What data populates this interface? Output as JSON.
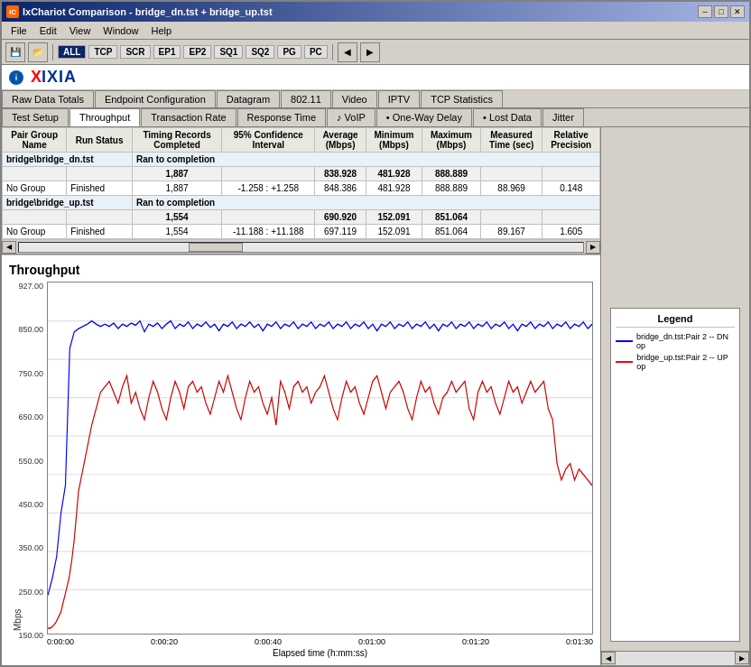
{
  "window": {
    "title": "IxChariot Comparison - bridge_dn.tst + bridge_up.tst",
    "icon": "IC"
  },
  "menu": {
    "items": [
      "File",
      "Edit",
      "View",
      "Window",
      "Help"
    ]
  },
  "toolbar": {
    "tags": [
      "ALL",
      "TCP",
      "SCR",
      "EP1",
      "EP2",
      "SQ1",
      "SQ2",
      "PG",
      "PC"
    ]
  },
  "tabs_row1": {
    "items": [
      "Raw Data Totals",
      "Endpoint Configuration",
      "Datagram",
      "802.11",
      "Video",
      "IPTV",
      "TCP Statistics"
    ]
  },
  "tabs_row2": {
    "items": [
      "Test Setup",
      "Throughput",
      "Transaction Rate",
      "Response Time",
      "VoIP",
      "One-Way Delay",
      "Lost Data",
      "Jitter"
    ]
  },
  "table": {
    "headers": {
      "pair_group_name": "Pair Group Name",
      "run_status": "Run Status",
      "timing_records_completed": "Timing Records Completed",
      "confidence_interval": "95% Confidence Interval",
      "average_mbps": "Average (Mbps)",
      "minimum_mbps": "Minimum (Mbps)",
      "maximum_mbps": "Maximum (Mbps)",
      "measured_time": "Measured Time (sec)",
      "relative_precision": "Relative Precision"
    },
    "rows": [
      {
        "type": "file",
        "file": "bridge\\bridge_dn.tst",
        "run_status": "Ran to completion",
        "timing_records": "",
        "confidence": "",
        "average": "",
        "minimum": "",
        "maximum": "",
        "measured_time": "",
        "relative_precision": ""
      },
      {
        "type": "summary",
        "file": "",
        "run_status": "",
        "timing_records": "1,887",
        "confidence": "",
        "average": "838.928",
        "minimum": "481.928",
        "maximum": "888.889",
        "measured_time": "",
        "relative_precision": ""
      },
      {
        "type": "detail",
        "pair_group": "No Group",
        "run_status": "Finished",
        "timing_records": "1,887",
        "confidence": "-1.258 : +1.258",
        "average": "848.386",
        "minimum": "481.928",
        "maximum": "888.889",
        "measured_time": "88.969",
        "relative_precision": "0.148"
      },
      {
        "type": "file",
        "file": "bridge\\bridge_up.tst",
        "run_status": "Ran to completion",
        "timing_records": "",
        "confidence": "",
        "average": "",
        "minimum": "",
        "maximum": "",
        "measured_time": "",
        "relative_precision": ""
      },
      {
        "type": "summary",
        "file": "",
        "run_status": "",
        "timing_records": "1,554",
        "confidence": "",
        "average": "690.920",
        "minimum": "152.091",
        "maximum": "851.064",
        "measured_time": "",
        "relative_precision": ""
      },
      {
        "type": "detail",
        "pair_group": "No Group",
        "run_status": "Finished",
        "timing_records": "1,554",
        "confidence": "-11.188 : +11.188",
        "average": "697.119",
        "minimum": "152.091",
        "maximum": "851.064",
        "measured_time": "89.167",
        "relative_precision": "1.605"
      }
    ]
  },
  "chart": {
    "title": "Throughput",
    "y_label": "Mbps",
    "y_axis": [
      "927.00",
      "850.00",
      "750.00",
      "650.00",
      "550.00",
      "450.00",
      "350.00",
      "250.00",
      "150.00"
    ],
    "x_axis": [
      "0:00:00",
      "0:00:20",
      "0:00:40",
      "0:01:00",
      "0:01:20",
      "0:01:30"
    ],
    "x_label": "Elapsed time (h:mm:ss)"
  },
  "legend": {
    "title": "Legend",
    "items": [
      {
        "color": "blue",
        "label": "bridge_dn.tst:Pair 2 -- DN op"
      },
      {
        "color": "red",
        "label": "bridge_up.tst:Pair 2 -- UP op"
      }
    ]
  }
}
